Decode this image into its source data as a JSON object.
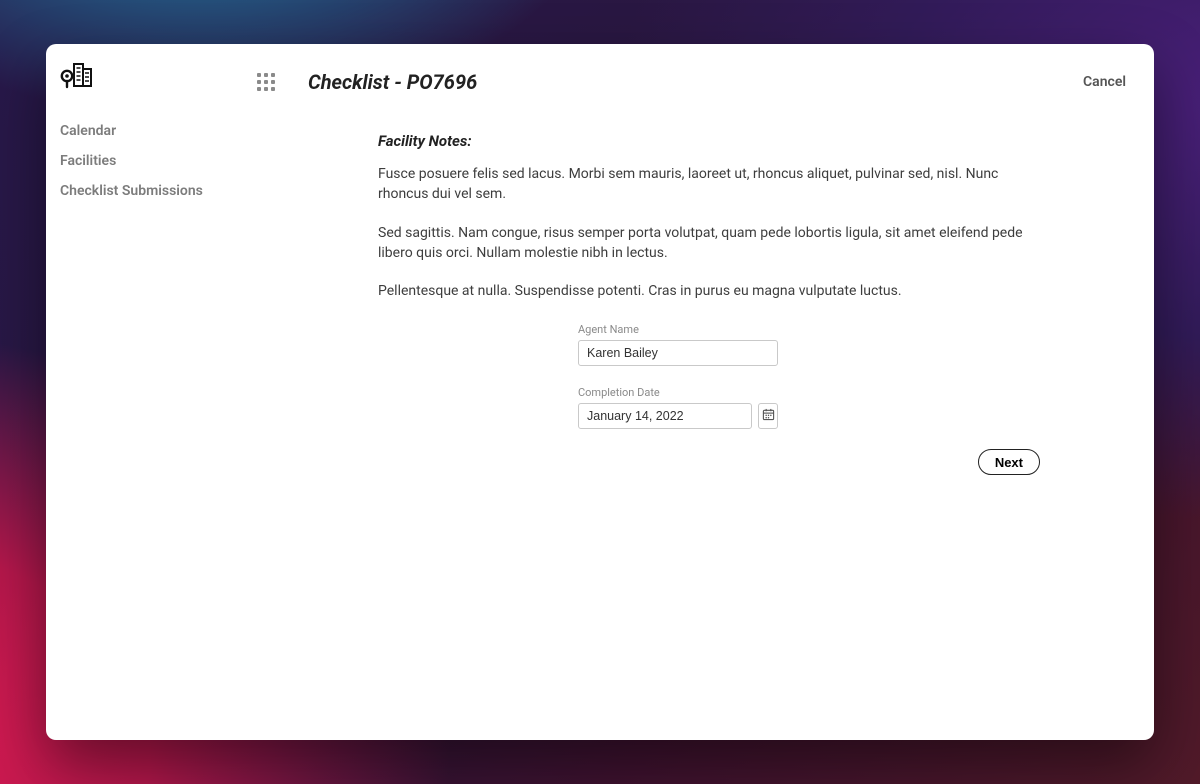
{
  "sidebar": {
    "items": [
      {
        "label": "Calendar"
      },
      {
        "label": "Facilities"
      },
      {
        "label": "Checklist Submissions"
      }
    ]
  },
  "header": {
    "title": "Checklist - PO7696",
    "cancel_label": "Cancel"
  },
  "facility_notes": {
    "heading": "Facility Notes:",
    "paragraphs": [
      "Fusce posuere felis sed lacus. Morbi sem mauris, laoreet ut, rhoncus aliquet, pulvinar sed, nisl. Nunc rhoncus dui vel sem.",
      "Sed sagittis. Nam congue, risus semper porta volutpat, quam pede lobortis ligula, sit amet eleifend pede libero quis orci. Nullam molestie nibh in lectus.",
      "Pellentesque at nulla. Suspendisse potenti. Cras in purus eu magna vulputate luctus."
    ]
  },
  "form": {
    "agent_name_label": "Agent Name",
    "agent_name_value": "Karen Bailey",
    "completion_date_label": "Completion Date",
    "completion_date_value": "January 14, 2022"
  },
  "actions": {
    "next_label": "Next"
  }
}
